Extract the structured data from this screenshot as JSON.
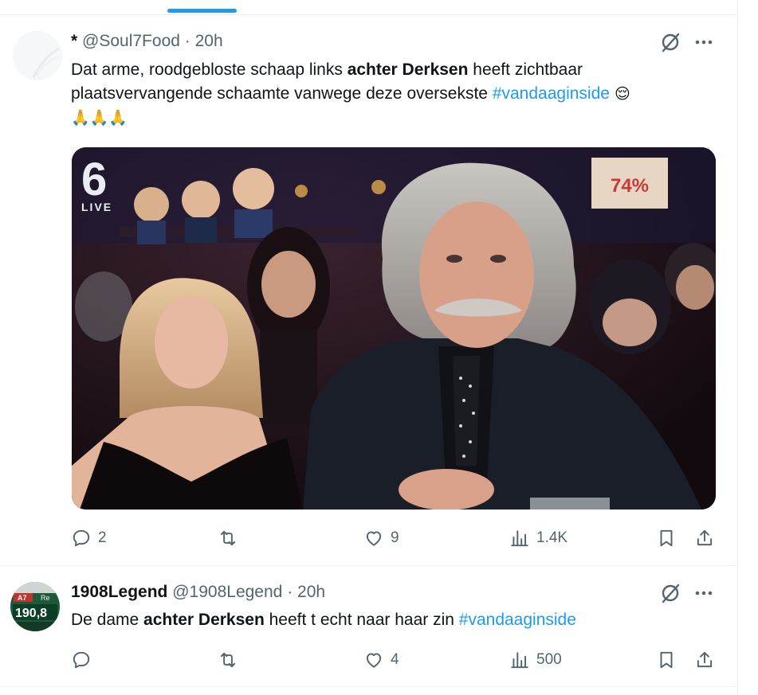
{
  "tweets": [
    {
      "display_name": "*",
      "handle": "@Soul7Food",
      "separator": "·",
      "time": "20h",
      "text_part1": "Dat arme, roodgebloste schaap links ",
      "text_bold": "achter Derksen",
      "text_part2": " heeft zichtbaar plaatsvervangende schaamte vanwege deze oversekste ",
      "hashtag": "#vandaaginside",
      "emoji_after": " 😌",
      "emoji_line": "🙏🙏🙏",
      "media": {
        "channel_logo": "6",
        "live_label": "LIVE",
        "sign_text": "74%"
      },
      "replies": "2",
      "retweets": "",
      "likes": "9",
      "views": "1.4K"
    },
    {
      "display_name": "1908Legend",
      "handle": "@1908Legend",
      "separator": "·",
      "time": "20h",
      "text_part1": "De dame ",
      "text_bold": "achter Derksen",
      "text_part2": " heeft t echt naar haar zin ",
      "hashtag": "#vandaaginside",
      "avatar_text_top": "A7",
      "avatar_text_mid": "Re",
      "avatar_text_main": "190,8",
      "replies": "",
      "retweets": "",
      "likes": "4",
      "views": "500"
    }
  ],
  "icons": {
    "grok": "grok-slash-icon",
    "more": "more-dots-icon",
    "reply": "reply-icon",
    "retweet": "retweet-icon",
    "like": "heart-icon",
    "views": "views-bar-icon",
    "bookmark": "bookmark-icon",
    "share": "share-icon"
  },
  "colors": {
    "accent": "#1d9bf0",
    "secondary_text": "#536471",
    "primary_text": "#0f1419"
  }
}
